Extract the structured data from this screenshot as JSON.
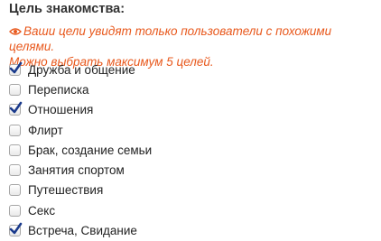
{
  "section": {
    "title": "Цель знакомства:",
    "hint_line1": "Ваши цели увидят только пользователи с похожими целями.",
    "hint_line2": "Можно выбрать максимум 5 целей.",
    "hint_icon": "eye-icon",
    "hint_color": "#e8581c",
    "check_color": "#1a3a8c"
  },
  "options": [
    {
      "label": "Дружба и общение",
      "checked": true
    },
    {
      "label": "Переписка",
      "checked": false
    },
    {
      "label": "Отношения",
      "checked": true
    },
    {
      "label": "Флирт",
      "checked": false
    },
    {
      "label": "Брак, создание семьи",
      "checked": false
    },
    {
      "label": "Занятия спортом",
      "checked": false
    },
    {
      "label": "Путешествия",
      "checked": false
    },
    {
      "label": "Секс",
      "checked": false
    },
    {
      "label": "Встреча, Свидание",
      "checked": true
    }
  ]
}
